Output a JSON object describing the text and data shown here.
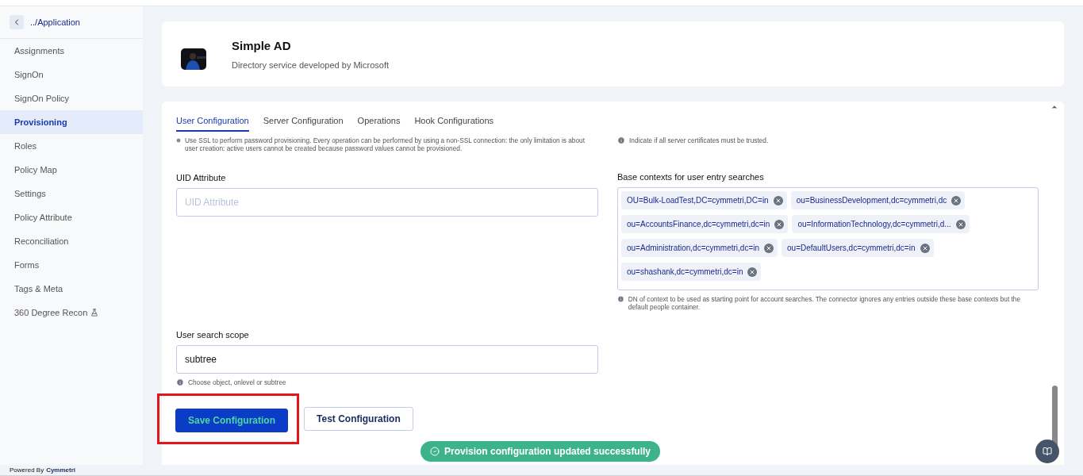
{
  "sidebar": {
    "back_link": "../Application",
    "items": [
      {
        "label": "Assignments",
        "selected": false
      },
      {
        "label": "SignOn",
        "selected": false
      },
      {
        "label": "SignOn Policy",
        "selected": false
      },
      {
        "label": "Provisioning",
        "selected": true
      },
      {
        "label": "Roles",
        "selected": false
      },
      {
        "label": "Policy Map",
        "selected": false
      },
      {
        "label": "Settings",
        "selected": false
      },
      {
        "label": "Policy Attribute",
        "selected": false
      },
      {
        "label": "Reconciliation",
        "selected": false
      },
      {
        "label": "Forms",
        "selected": false
      },
      {
        "label": "Tags & Meta",
        "selected": false
      },
      {
        "label": "360 Degree Recon",
        "selected": false,
        "beta": true
      }
    ],
    "powered_by": "Powered By",
    "brand": "Cymmetri"
  },
  "app": {
    "title": "Simple AD",
    "description": "Directory service developed by Microsoft"
  },
  "tabs": [
    {
      "label": "User Configuration",
      "selected": true
    },
    {
      "label": "Server Configuration",
      "selected": false
    },
    {
      "label": "Operations",
      "selected": false
    },
    {
      "label": "Hook Configurations",
      "selected": false
    }
  ],
  "left_hint": "Use SSL to perform password provisioning. Every operation can be performed by using a non-SSL connection: the only limitation is about user creation: active users cannot be created because password values cannot be provisioned.",
  "right_hint": "Indicate if all server certificates must be trusted.",
  "uid_field": {
    "label": "UID Attribute",
    "placeholder": "UID Attribute"
  },
  "base_contexts": {
    "label": "Base contexts for user entry searches",
    "chips": [
      "OU=Bulk-LoadTest,DC=cymmetri,DC=in",
      "ou=BusinessDevelopment,dc=cymmetri,dc",
      "ou=AccountsFinance,dc=cymmetri,dc=in",
      "ou=InformationTechnology,dc=cymmetri,d...",
      "ou=Administration,dc=cymmetri,dc=in",
      "ou=DefaultUsers,dc=cymmetri,dc=in",
      "ou=shashank,dc=cymmetri,dc=in"
    ],
    "hint": "DN of context to be used as starting point for account searches. The connector ignores any entries outside these base contexts but the default people container."
  },
  "scope_field": {
    "label": "User search scope",
    "value": "subtree",
    "hint": "Choose object, onlevel or subtree"
  },
  "buttons": [
    {
      "label": "Save Configuration",
      "kind": "primary",
      "highlighted": true
    },
    {
      "label": "Test Configuration",
      "kind": "secondary",
      "highlighted": false
    }
  ],
  "toast": "Provision configuration updated successfully"
}
